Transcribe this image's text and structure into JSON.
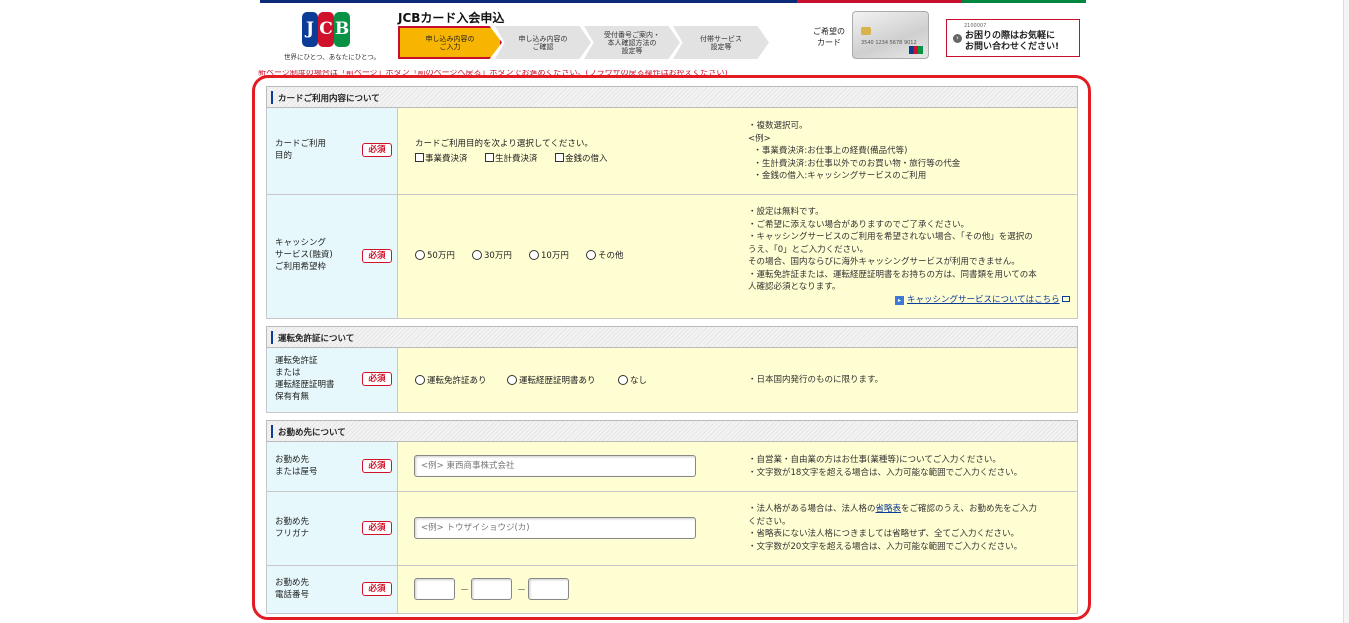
{
  "header": {
    "logo_letters": [
      "J",
      "C",
      "B"
    ],
    "tagline": "世界にひとつ、あなたにひとつ。",
    "title": "JCBカード入会申込",
    "steps": [
      {
        "lines": [
          "申し込み内容の",
          "ご入力"
        ],
        "state": "current"
      },
      {
        "lines": [
          "申し込み内容の",
          "ご確認"
        ],
        "state": "todo"
      },
      {
        "lines": [
          "受付番号ご案内・",
          "本人確認方法の",
          "設定等"
        ],
        "state": "todo"
      },
      {
        "lines": [
          "付帯サービス",
          "設定等"
        ],
        "state": "todo"
      }
    ],
    "card_label": [
      "ご希望の",
      "カード"
    ],
    "card_number": "3540 1234 5678 9012",
    "help_small": "2100007",
    "help_lines": [
      "お困りの際はお気軽に",
      "お問い合わせください!"
    ]
  },
  "notice": "新ページ制度の場合は「前ページ」ボタン「前のページへ戻る」ボタンでお進めください。(ブラウザの戻る操作はお控えください)",
  "sections": {
    "usage": "カードご利用内容について",
    "license": "運転免許証について",
    "work": "お勤め先について"
  },
  "required_label": "必須",
  "rows": {
    "purpose": {
      "label": [
        "カードご利用",
        "目的"
      ],
      "prompt": "カードご利用目的を次より選択してください。",
      "options": [
        "事業費決済",
        "生計費決済",
        "金銭の借入"
      ],
      "note": "・複数選択可。\n<例>\n  ・事業費決済:お仕事上の経費(備品代等)\n  ・生計費決済:お仕事以外でのお買い物・旅行等の代金\n  ・金銭の借入:キャッシングサービスのご利用"
    },
    "cashing": {
      "label": [
        "キャッシング",
        "サービス(融資)",
        "ご利用希望枠"
      ],
      "options": [
        "50万円",
        "30万円",
        "10万円",
        "その他"
      ],
      "note": "・設定は無料です。\n・ご希望に添えない場合がありますのでご了承ください。\n・キャッシングサービスのご利用を希望されない場合、「その他」を選択の\nうえ、「0」とご入力ください。\nその場合、国内ならびに海外キャッシングサービスが利用できません。\n・運転免許証または、運転経歴証明書をお持ちの方は、同書類を用いての本\n人確認必須となります。",
      "link": "キャッシングサービスについてはこちら"
    },
    "license": {
      "label": [
        "運転免許証",
        "または",
        "運転経歴証明書",
        "保有有無"
      ],
      "options": [
        "運転免許証あり",
        "運転経歴証明書あり",
        "なし"
      ],
      "note": "・日本国内発行のものに限ります。"
    },
    "company": {
      "label": [
        "お勤め先",
        "または屋号"
      ],
      "placeholder": "<例> 東西商事株式会社",
      "note": "・自営業・自由業の方はお仕事(業種等)についてご入力ください。\n・文字数が18文字を超える場合は、入力可能な範囲でご入力ください。"
    },
    "company_kana": {
      "label": [
        "お勤め先",
        "フリガナ"
      ],
      "placeholder": "<例> トウザイショウジ(カ)",
      "note_pre": "・法人格がある場合は、法人格の",
      "note_link": "省略表",
      "note_post": "をご確認のうえ、お勤め先をご入力",
      "note_rest": "ください。\n・省略表にない法人格につきましては省略せず、全てご入力ください。\n・文字数が20文字を超える場合は、入力可能な範囲でご入力ください。"
    },
    "phone": {
      "label": [
        "お勤め先",
        "電話番号"
      ],
      "separator": "－"
    }
  }
}
